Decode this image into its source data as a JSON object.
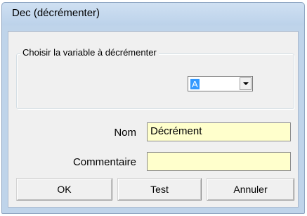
{
  "window": {
    "title": "Dec (décrémenter)"
  },
  "group": {
    "legend": "Choisir la variable à décrémenter",
    "variable_selected": "A"
  },
  "form": {
    "nom_label": "Nom",
    "nom_value": "Décrément",
    "commentaire_label": "Commentaire",
    "commentaire_value": ""
  },
  "buttons": {
    "ok": "OK",
    "test": "Test",
    "cancel": "Annuler"
  },
  "icons": {
    "combo_arrow": "chevron-down-icon"
  },
  "colors": {
    "field_background": "#ffffcc",
    "selection": "#3399ff",
    "titlebar": "#bfd4ea"
  }
}
